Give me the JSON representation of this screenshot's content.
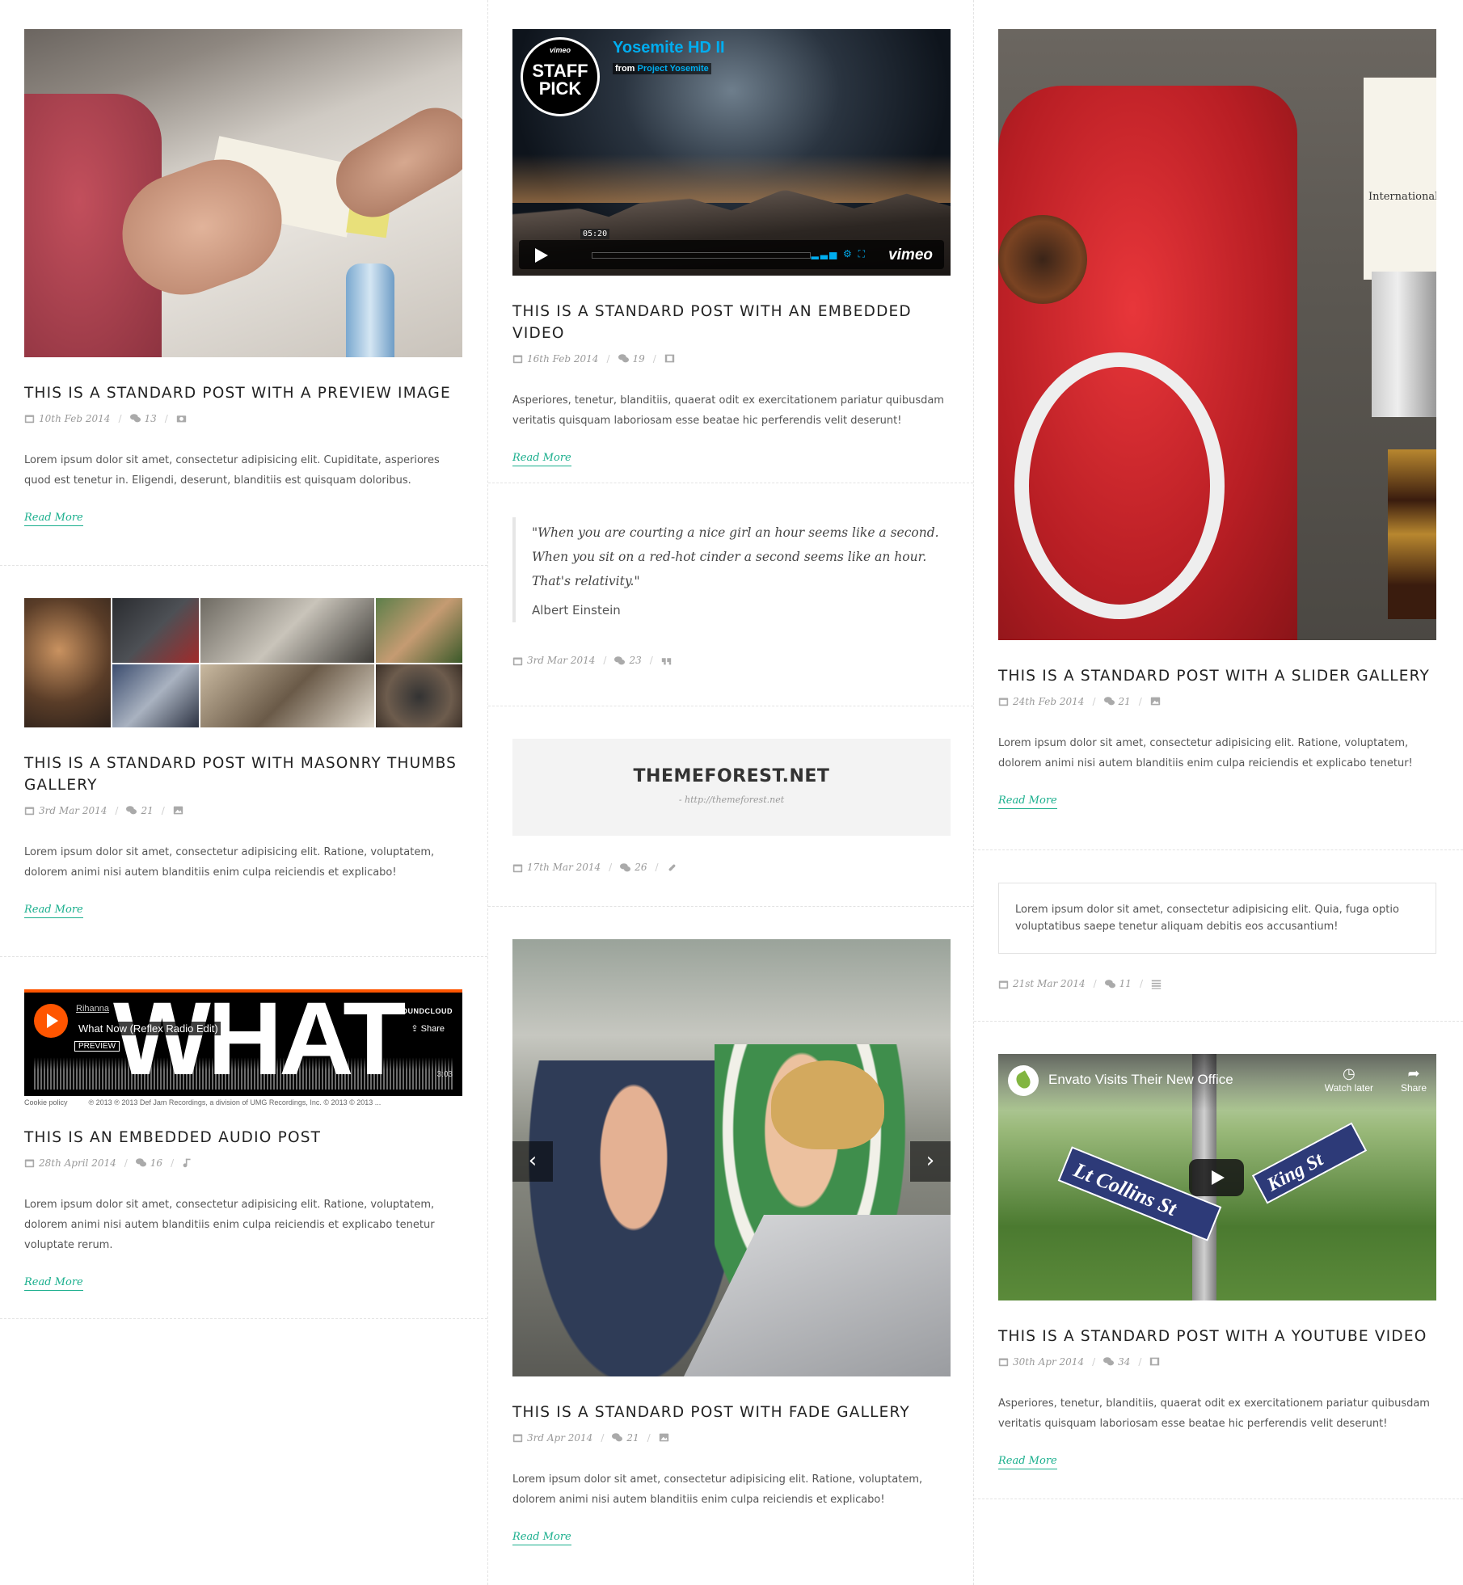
{
  "read_more": "Read More",
  "posts_col1": [
    {
      "title": "This is a standard post with a preview image",
      "date": "10th Feb 2014",
      "comments": "13",
      "format_icon": "camera-icon",
      "excerpt": "Lorem ipsum dolor sit amet, consectetur adipisicing elit. Cupiditate, asperiores quod est tenetur in. Eligendi, deserunt, blanditiis est quisquam doloribus."
    },
    {
      "title": "This is a standard post with masonry thumbs gallery",
      "date": "3rd Mar 2014",
      "comments": "21",
      "format_icon": "image-icon",
      "excerpt": "Lorem ipsum dolor sit amet, consectetur adipisicing elit. Ratione, voluptatem, dolorem animi nisi autem blanditiis enim culpa reiciendis et explicabo!"
    },
    {
      "title": "This is an embedded audio post",
      "date": "28th April 2014",
      "comments": "16",
      "format_icon": "music-icon",
      "excerpt": "Lorem ipsum dolor sit amet, consectetur adipisicing elit. Ratione, voluptatem, dolorem animi nisi autem blanditiis enim culpa reiciendis et explicabo tenetur voluptate rerum."
    }
  ],
  "audio_player": {
    "big_text": "WHAT",
    "artist": "Rihanna",
    "track": "What Now (Reflex Radio Edit)",
    "preview": "PREVIEW",
    "brand": "SOUNDCLOUD",
    "share": "Share",
    "duration": "3:03",
    "cookie": "Cookie policy",
    "copyright": "℗ 2013 ℗ 2013 Def Jam Recordings, a division of UMG Recordings, Inc. © 2013 © 2013 ..."
  },
  "posts_col2": {
    "video_post": {
      "title": "This is a standard post with an embedded video",
      "date": "16th Feb 2014",
      "comments": "19",
      "format_icon": "film-icon",
      "excerpt": "Asperiores, tenetur, blanditiis, quaerat odit ex exercitationem pariatur quibusdam veritatis quisquam laboriosam esse beatae hic perferendis velit deserunt!"
    },
    "quote_post": {
      "quote": "\"When you are courting a nice girl an hour seems like a second. When you sit on a red-hot cinder a second seems like an hour. That's relativity.\"",
      "author": "Albert Einstein",
      "date": "3rd Mar 2014",
      "comments": "23",
      "format_icon": "quote-icon"
    },
    "link_post": {
      "link_title": "THEMEFOREST.NET",
      "link_url": "- http://themeforest.net",
      "date": "17th Mar 2014",
      "comments": "26",
      "format_icon": "link-icon"
    },
    "fade_post": {
      "title": "This is a standard post with fade gallery",
      "date": "3rd Apr 2014",
      "comments": "21",
      "format_icon": "image-icon",
      "excerpt": "Lorem ipsum dolor sit amet, consectetur adipisicing elit. Ratione, voluptatem, dolorem animi nisi autem blanditiis enim culpa reiciendis et explicabo!",
      "prev": "‹",
      "next": "›"
    }
  },
  "vimeo_player": {
    "badge_top": "vimeo",
    "badge_line1": "STAFF",
    "badge_line2": "PICK",
    "title": "Yosemite HD II",
    "from_label": "from",
    "from_name": "Project Yosemite",
    "time": "05:20",
    "brand": "vimeo"
  },
  "posts_col3": {
    "slider_post": {
      "title": "This is a standard post with a slider gallery",
      "date": "24th Feb 2014",
      "comments": "21",
      "format_icon": "image-icon",
      "excerpt": "Lorem ipsum dolor sit amet, consectetur adipisicing elit. Ratione, voluptatem, dolorem animi nisi autem blanditiis enim culpa reiciendis et explicabo tenetur!",
      "card_text": "International"
    },
    "status_post": {
      "text": "Lorem ipsum dolor sit amet, consectetur adipisicing elit. Quia, fuga optio voluptatibus saepe tenetur aliquam debitis eos accusantium!",
      "date": "21st Mar 2014",
      "comments": "11",
      "format_icon": "list-icon"
    },
    "youtube_post": {
      "title": "This is a standard post with a youtube video",
      "date": "30th Apr 2014",
      "comments": "34",
      "format_icon": "film-icon",
      "excerpt": "Asperiores, tenetur, blanditiis, quaerat odit ex exercitationem pariatur quibusdam veritatis quisquam laboriosam esse beatae hic perferendis velit deserunt!"
    }
  },
  "youtube_player": {
    "title": "Envato Visits Their New Office",
    "watch_later": "Watch later",
    "share": "Share",
    "sign1": "Lt Collins St",
    "sign2": "King St"
  },
  "colors": {
    "accent": "#1aaf8d",
    "meta": "#999999",
    "heading": "#222222"
  }
}
